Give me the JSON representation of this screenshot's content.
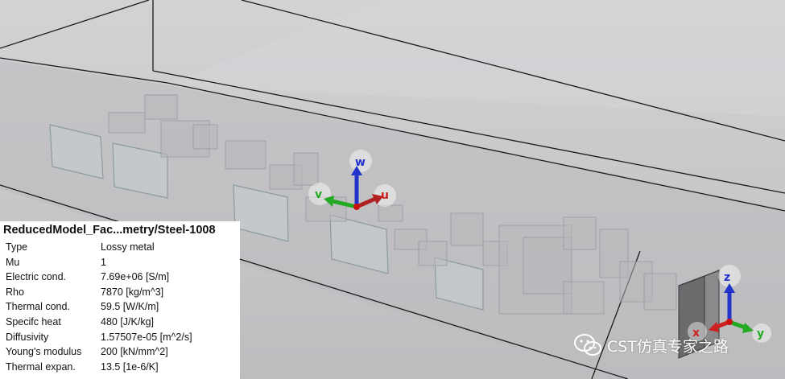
{
  "viewport": {
    "background": "#c9c9cb",
    "wireframe_color": "#1a1a1a",
    "local_axes": {
      "labels": [
        "w",
        "v",
        "u"
      ],
      "colors": {
        "w": "#2233cc",
        "v": "#22aa22",
        "u": "#cc2222"
      }
    },
    "global_axes": {
      "labels": [
        "z",
        "x",
        "y"
      ],
      "colors": {
        "z": "#2233cc",
        "x": "#cc2222",
        "y": "#22aa22"
      }
    }
  },
  "material_info": {
    "title": "ReducedModel_Fac...metry/Steel-1008",
    "rows": [
      {
        "key": "Type",
        "value": "Lossy metal"
      },
      {
        "key": "Mu",
        "value": "1"
      },
      {
        "key": "Electric cond.",
        "value": "7.69e+06 [S/m]"
      },
      {
        "key": "Rho",
        "value": "7870 [kg/m^3]"
      },
      {
        "key": "Thermal cond.",
        "value": "59.5 [W/K/m]"
      },
      {
        "key": "Specifc heat",
        "value": "480 [J/K/kg]"
      },
      {
        "key": "Diffusivity",
        "value": "1.57507e-05 [m^2/s]"
      },
      {
        "key": "Young's modulus",
        "value": "200 [kN/mm^2]"
      },
      {
        "key": "Thermal expan.",
        "value": "13.5 [1e-6/K]"
      }
    ]
  },
  "watermark": {
    "text": "CST仿真专家之路",
    "icon": "wechat-icon"
  }
}
